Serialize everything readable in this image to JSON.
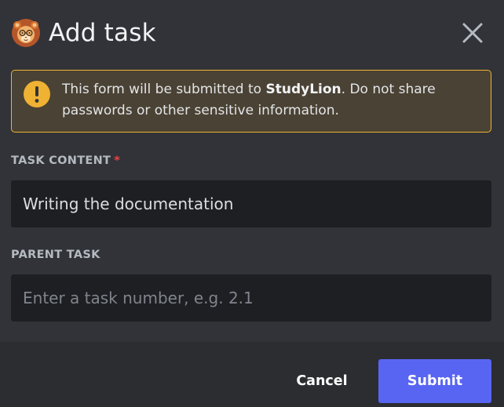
{
  "dialog": {
    "title": "Add task",
    "avatar_icon": "lion-avatar-icon",
    "close_icon": "close-icon"
  },
  "warning": {
    "icon": "exclamation-icon",
    "text_prefix": "This form will be submitted to ",
    "app_name": "StudyLion",
    "text_suffix": ". Do not share passwords or other sensitive information.",
    "border_color": "#f0b232",
    "background_color": "#4a4234"
  },
  "fields": {
    "task_content": {
      "label": "TASK CONTENT",
      "required_marker": "*",
      "value": "Writing the documentation"
    },
    "parent_task": {
      "label": "PARENT TASK",
      "placeholder": "Enter a task number, e.g. 2.1",
      "value": ""
    }
  },
  "footer": {
    "cancel_label": "Cancel",
    "submit_label": "Submit",
    "submit_color": "#5865f2"
  }
}
